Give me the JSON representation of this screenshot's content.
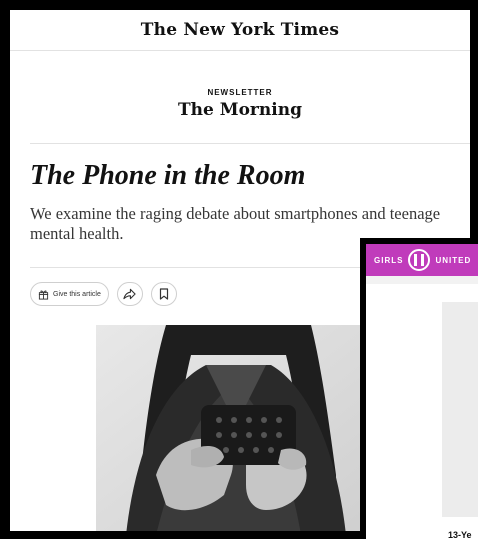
{
  "header": {
    "logo_text": "The New York Times"
  },
  "newsletter": {
    "kicker": "NEWSLETTER",
    "title": "The Morning"
  },
  "article": {
    "headline": "The Phone in the Room",
    "summary": "We examine the raging debate about smartphones and teenage mental health."
  },
  "actions": {
    "gift_label": "Give this article",
    "share_icon": "share-icon",
    "save_icon": "bookmark-icon"
  },
  "overlay": {
    "brand_left": "GIRLS",
    "brand_right": "UNITED",
    "caption": "13-Ye",
    "brand_color": "#c03bbb"
  }
}
